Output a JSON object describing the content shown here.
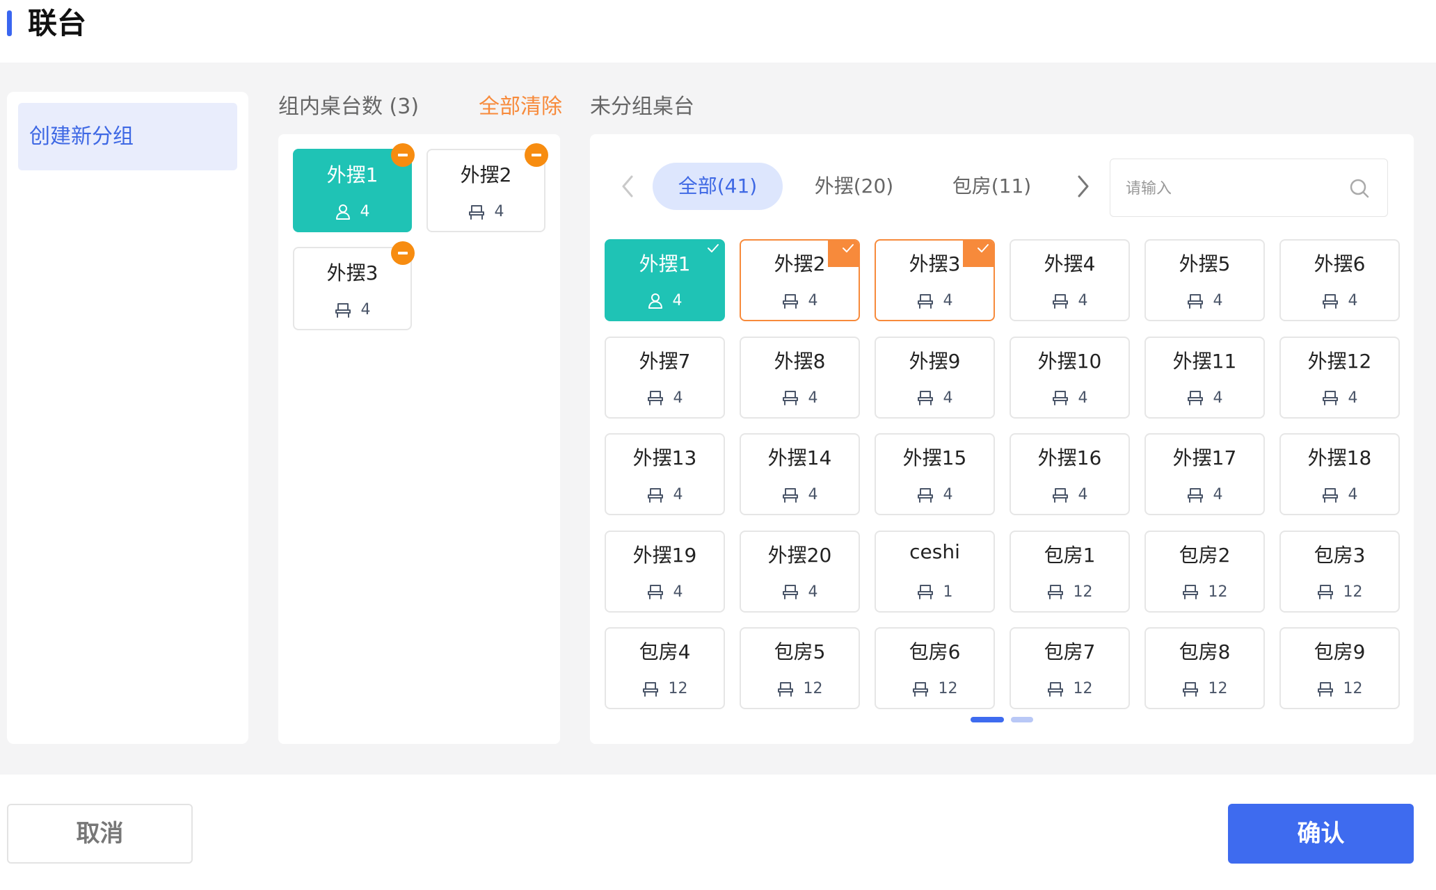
{
  "header": {
    "title": "联台"
  },
  "left": {
    "create_group_label": "创建新分组"
  },
  "mid": {
    "heading": "组内桌台数 (3)",
    "clear_all": "全部清除",
    "cards": [
      {
        "name": "外摆1",
        "count": "4",
        "state": "green"
      },
      {
        "name": "外摆2",
        "count": "4",
        "state": "normal"
      },
      {
        "name": "外摆3",
        "count": "4",
        "state": "normal"
      }
    ]
  },
  "right": {
    "heading": "未分组桌台",
    "tabs": [
      {
        "label": "全部(41)",
        "active": true
      },
      {
        "label": "外摆(20)",
        "active": false
      },
      {
        "label": "包房(11)",
        "active": false
      }
    ],
    "search_placeholder": "请输入",
    "tables": [
      {
        "name": "外摆1",
        "count": "4",
        "state": "green"
      },
      {
        "name": "外摆2",
        "count": "4",
        "state": "orange"
      },
      {
        "name": "外摆3",
        "count": "4",
        "state": "orange"
      },
      {
        "name": "外摆4",
        "count": "4",
        "state": "normal"
      },
      {
        "name": "外摆5",
        "count": "4",
        "state": "normal"
      },
      {
        "name": "外摆6",
        "count": "4",
        "state": "normal"
      },
      {
        "name": "外摆7",
        "count": "4",
        "state": "normal"
      },
      {
        "name": "外摆8",
        "count": "4",
        "state": "normal"
      },
      {
        "name": "外摆9",
        "count": "4",
        "state": "normal"
      },
      {
        "name": "外摆10",
        "count": "4",
        "state": "normal"
      },
      {
        "name": "外摆11",
        "count": "4",
        "state": "normal"
      },
      {
        "name": "外摆12",
        "count": "4",
        "state": "normal"
      },
      {
        "name": "外摆13",
        "count": "4",
        "state": "normal"
      },
      {
        "name": "外摆14",
        "count": "4",
        "state": "normal"
      },
      {
        "name": "外摆15",
        "count": "4",
        "state": "normal"
      },
      {
        "name": "外摆16",
        "count": "4",
        "state": "normal"
      },
      {
        "name": "外摆17",
        "count": "4",
        "state": "normal"
      },
      {
        "name": "外摆18",
        "count": "4",
        "state": "normal"
      },
      {
        "name": "外摆19",
        "count": "4",
        "state": "normal"
      },
      {
        "name": "外摆20",
        "count": "4",
        "state": "normal"
      },
      {
        "name": "ceshi",
        "count": "1",
        "state": "normal"
      },
      {
        "name": "包房1",
        "count": "12",
        "state": "normal"
      },
      {
        "name": "包房2",
        "count": "12",
        "state": "normal"
      },
      {
        "name": "包房3",
        "count": "12",
        "state": "normal"
      },
      {
        "name": "包房4",
        "count": "12",
        "state": "normal"
      },
      {
        "name": "包房5",
        "count": "12",
        "state": "normal"
      },
      {
        "name": "包房6",
        "count": "12",
        "state": "normal"
      },
      {
        "name": "包房7",
        "count": "12",
        "state": "normal"
      },
      {
        "name": "包房8",
        "count": "12",
        "state": "normal"
      },
      {
        "name": "包房9",
        "count": "12",
        "state": "normal"
      }
    ],
    "pagination": {
      "pages": 2,
      "current": 1
    }
  },
  "footer": {
    "cancel_label": "取消",
    "confirm_label": "确认"
  },
  "colors": {
    "accent_blue": "#3e6bef",
    "selected_green": "#1fc3b5",
    "selected_orange": "#f78a3b",
    "badge_orange": "#f78c10"
  }
}
